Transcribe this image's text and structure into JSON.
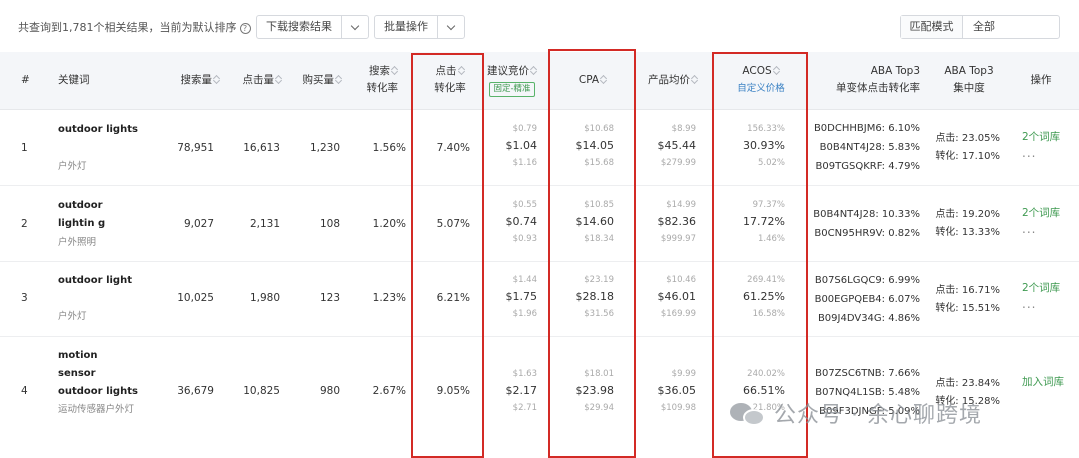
{
  "toolbar": {
    "summary": "共查询到1,781个相关结果，当前为默认排序",
    "help_glyph": "?",
    "download_label": "下载搜索结果",
    "batch_label": "批量操作",
    "match_label": "匹配模式",
    "match_value": "全部"
  },
  "headers": {
    "index": "#",
    "keyword": "关键词",
    "search_volume": "搜索量",
    "clicks": "点击量",
    "purchases": "购买量",
    "search_cvr_1": "搜索",
    "search_cvr_2": "转化率",
    "click_cvr_1": "点击",
    "click_cvr_2": "转化率",
    "bid": "建议竞价",
    "bid_tag": "固定-精准",
    "cpa": "CPA",
    "avg_price": "产品均价",
    "acos": "ACOS",
    "acos_link": "自定义价格",
    "aba_1": "ABA Top3",
    "aba_2": "单变体点击转化率",
    "aba_conc_1": "ABA Top3",
    "aba_conc_2": "集中度",
    "action": "操作"
  },
  "rows": [
    {
      "index": "1",
      "keyword_en": "outdoor lights",
      "keyword_cn": "户外灯",
      "search_volume": "78,951",
      "clicks": "16,613",
      "purchases": "1,230",
      "search_cvr": "1.56%",
      "click_cvr": "7.40%",
      "bid": {
        "low": "$0.79",
        "mid": "$1.04",
        "high": "$1.16"
      },
      "cpa": {
        "low": "$10.68",
        "mid": "$14.05",
        "high": "$15.68"
      },
      "price": {
        "low": "$8.99",
        "mid": "$45.44",
        "high": "$279.99"
      },
      "acos": {
        "low": "156.33%",
        "mid": "30.93%",
        "high": "5.02%"
      },
      "asins": [
        "B0DCHHBJM6: 6.10%",
        "B0B4NT4J28: 5.83%",
        "B09TGSQKRF: 4.79%"
      ],
      "concentration": {
        "click": "点击: 23.05%",
        "conv": "转化: 17.10%"
      },
      "action": "2个词库",
      "more": "..."
    },
    {
      "index": "2",
      "keyword_en": "outdoor lightin g",
      "keyword_cn": "户外照明",
      "search_volume": "9,027",
      "clicks": "2,131",
      "purchases": "108",
      "search_cvr": "1.20%",
      "click_cvr": "5.07%",
      "bid": {
        "low": "$0.55",
        "mid": "$0.74",
        "high": "$0.93"
      },
      "cpa": {
        "low": "$10.85",
        "mid": "$14.60",
        "high": "$18.34"
      },
      "price": {
        "low": "$14.99",
        "mid": "$82.36",
        "high": "$999.97"
      },
      "acos": {
        "low": "97.37%",
        "mid": "17.72%",
        "high": "1.46%"
      },
      "asins": [
        "B0B4NT4J28: 10.33%",
        "B0CN95HR9V: 0.82%"
      ],
      "concentration": {
        "click": "点击: 19.20%",
        "conv": "转化: 13.33%"
      },
      "action": "2个词库",
      "more": "..."
    },
    {
      "index": "3",
      "keyword_en": "outdoor light",
      "keyword_cn": "户外灯",
      "search_volume": "10,025",
      "clicks": "1,980",
      "purchases": "123",
      "search_cvr": "1.23%",
      "click_cvr": "6.21%",
      "bid": {
        "low": "$1.44",
        "mid": "$1.75",
        "high": "$1.96"
      },
      "cpa": {
        "low": "$23.19",
        "mid": "$28.18",
        "high": "$31.56"
      },
      "price": {
        "low": "$10.46",
        "mid": "$46.01",
        "high": "$169.99"
      },
      "acos": {
        "low": "269.41%",
        "mid": "61.25%",
        "high": "16.58%"
      },
      "asins": [
        "B07S6LGQC9: 6.99%",
        "B00EGPQEB4: 6.07%",
        "B09J4DV34G: 4.86%"
      ],
      "concentration": {
        "click": "点击: 16.71%",
        "conv": "转化: 15.51%"
      },
      "action": "2个词库",
      "more": "..."
    },
    {
      "index": "4",
      "keyword_en": "motion sensor outdoor lights",
      "keyword_cn": "运动传感器户外灯",
      "search_volume": "36,679",
      "clicks": "10,825",
      "purchases": "980",
      "search_cvr": "2.67%",
      "click_cvr": "9.05%",
      "bid": {
        "low": "$1.63",
        "mid": "$2.17",
        "high": "$2.71"
      },
      "cpa": {
        "low": "$18.01",
        "mid": "$23.98",
        "high": "$29.94"
      },
      "price": {
        "low": "$9.99",
        "mid": "$36.05",
        "high": "$109.98"
      },
      "acos": {
        "low": "240.02%",
        "mid": "66.51%",
        "high": "21.80%"
      },
      "asins": [
        "B07ZSC6TNB: 7.66%",
        "B07NQ4L1SB: 5.48%",
        "B09F3DJNGF: 5.09%"
      ],
      "concentration": {
        "click": "点击: 23.84%",
        "conv": "转化: 15.28%"
      },
      "action": "加入词库",
      "more": ""
    }
  ],
  "watermark": "公众号 · 余心聊跨境"
}
